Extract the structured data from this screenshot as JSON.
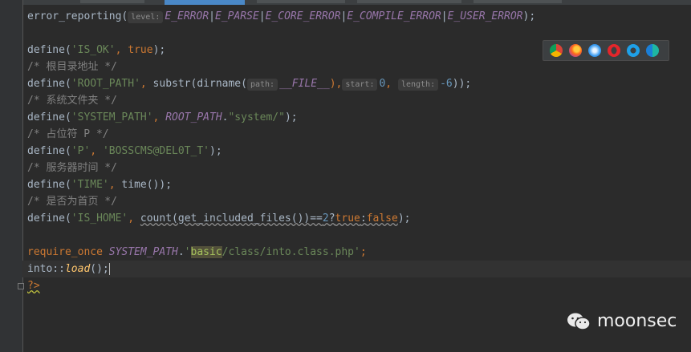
{
  "editor": {
    "line1": {
      "fn": "error_reporting(",
      "hint_level": "level:",
      "c1": "E_ERROR",
      "c2": "E_PARSE",
      "c3": "E_CORE_ERROR",
      "c4": "E_COMPILE_ERROR",
      "c5": "E_USER_ERROR",
      "pipe": "|",
      "end": ");"
    },
    "define": "define(",
    "close": ");",
    "comma": ", ",
    "line3": {
      "name": "'IS_OK'",
      "val": "true"
    },
    "line4": {
      "comment": "/* 根目录地址 */"
    },
    "line5": {
      "name": "'ROOT_PATH'",
      "fn1": "substr(dirname(",
      "hint_path": "path:",
      "file_const": "__FILE__",
      "paren_comma": "),",
      "hint_start": "start:",
      "start_val": "0",
      "hint_length": "length:",
      "length_val": "-6",
      "end": "));"
    },
    "line6": {
      "comment": "/* 系统文件夹 */"
    },
    "line7": {
      "name": "'SYSTEM_PATH'",
      "const": "ROOT_PATH",
      "dot": ".",
      "str": "\"system/\""
    },
    "line8": {
      "comment": "/* 占位符 P */"
    },
    "line9": {
      "name": "'P'",
      "str": "'BOSSCMS@DEL0T_T'"
    },
    "line10": {
      "comment": "/* 服务器时间 */"
    },
    "line11": {
      "name": "'TIME'",
      "fn": "time()"
    },
    "line12": {
      "comment": "/* 是否为首页 */"
    },
    "line13": {
      "name": "'IS_HOME'",
      "expr": "count(get_included_files())==",
      "num": "2",
      "q": "?",
      "t": "true",
      "colon": ":",
      "f": "false"
    },
    "line15": {
      "kw": "require_once",
      "const": "SYSTEM_PATH",
      "dot": ".",
      "quote": "'",
      "basic": "basic",
      "rest": "/class/into.class.php'",
      "semi": ";"
    },
    "line16": {
      "cls": "into::",
      "fn": "load",
      "end": "();"
    },
    "line17": {
      "tag": "?>"
    }
  },
  "browsers": [
    "chrome-icon",
    "firefox-icon",
    "safari-icon",
    "opera-icon",
    "ie-icon",
    "edge-icon"
  ],
  "watermark": {
    "text": "moonsec"
  }
}
